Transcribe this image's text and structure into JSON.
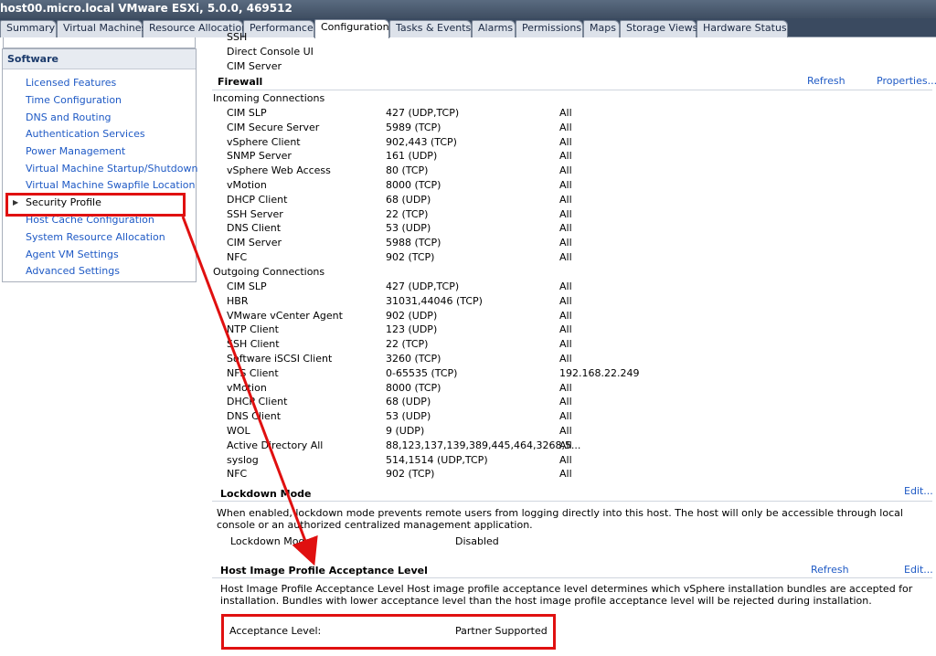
{
  "window": {
    "title": "host00.micro.local VMware ESXi, 5.0.0, 469512"
  },
  "tabs": [
    "Summary",
    "Virtual Machines",
    "Resource Allocation",
    "Performance",
    "Configuration",
    "Tasks & Events",
    "Alarms",
    "Permissions",
    "Maps",
    "Storage Views",
    "Hardware Status"
  ],
  "active_tab": "Configuration",
  "sidebar": {
    "header": "Software",
    "items": [
      "Licensed Features",
      "Time Configuration",
      "DNS and Routing",
      "Authentication Services",
      "Power Management",
      "Virtual Machine Startup/Shutdown",
      "Virtual Machine Swapfile Location",
      "Security Profile",
      "Host Cache Configuration",
      "System Resource Allocation",
      "Agent VM Settings",
      "Advanced Settings"
    ],
    "selected": "Security Profile"
  },
  "services_tail": [
    "SSH",
    "Direct Console UI",
    "CIM Server"
  ],
  "firewall": {
    "title": "Firewall",
    "refresh_label": "Refresh",
    "properties_label": "Properties...",
    "incoming_label": "Incoming Connections",
    "incoming": [
      [
        "CIM SLP",
        "427 (UDP,TCP)",
        "All"
      ],
      [
        "CIM Secure Server",
        "5989 (TCP)",
        "All"
      ],
      [
        "vSphere Client",
        "902,443 (TCP)",
        "All"
      ],
      [
        "SNMP Server",
        "161 (UDP)",
        "All"
      ],
      [
        "vSphere Web Access",
        "80 (TCP)",
        "All"
      ],
      [
        "vMotion",
        "8000 (TCP)",
        "All"
      ],
      [
        "DHCP Client",
        "68 (UDP)",
        "All"
      ],
      [
        "SSH Server",
        "22 (TCP)",
        "All"
      ],
      [
        "DNS Client",
        "53 (UDP)",
        "All"
      ],
      [
        "CIM Server",
        "5988 (TCP)",
        "All"
      ],
      [
        "NFC",
        "902 (TCP)",
        "All"
      ]
    ],
    "outgoing_label": "Outgoing Connections",
    "outgoing": [
      [
        "CIM SLP",
        "427 (UDP,TCP)",
        "All"
      ],
      [
        "HBR",
        "31031,44046 (TCP)",
        "All"
      ],
      [
        "VMware vCenter Agent",
        "902 (UDP)",
        "All"
      ],
      [
        "NTP Client",
        "123 (UDP)",
        "All"
      ],
      [
        "SSH Client",
        "22 (TCP)",
        "All"
      ],
      [
        "Software iSCSI Client",
        "3260 (TCP)",
        "All"
      ],
      [
        "NFS Client",
        "0-65535 (TCP)",
        "192.168.22.249"
      ],
      [
        "vMotion",
        "8000 (TCP)",
        "All"
      ],
      [
        "DHCP Client",
        "68 (UDP)",
        "All"
      ],
      [
        "DNS Client",
        "53 (UDP)",
        "All"
      ],
      [
        "WOL",
        "9 (UDP)",
        "All"
      ],
      [
        "Active Directory All",
        "88,123,137,139,389,445,464,3268,5...",
        "All"
      ],
      [
        "syslog",
        "514,1514 (UDP,TCP)",
        "All"
      ],
      [
        "NFC",
        "902 (TCP)",
        "All"
      ]
    ]
  },
  "lockdown": {
    "title": "Lockdown Mode",
    "edit_label": "Edit...",
    "description": "When enabled, lockdown mode prevents remote users from logging directly into this host. The host will only be accessible through local console or an authorized centralized management application.",
    "field_label": "Lockdown Mode",
    "field_value": "Disabled"
  },
  "acceptance": {
    "title": "Host Image Profile Acceptance Level",
    "refresh_label": "Refresh",
    "edit_label": "Edit...",
    "description": "Host Image Profile Acceptance Level Host image profile acceptance level determines which vSphere installation bundles are accepted for installation. Bundles with lower acceptance level than the host image profile acceptance level will be rejected during installation.",
    "field_label": "Acceptance Level:",
    "field_value": "Partner Supported"
  },
  "colors": {
    "link": "#1f5ac5",
    "annotation": "#e01010",
    "titlebar": "#4a5a70"
  }
}
